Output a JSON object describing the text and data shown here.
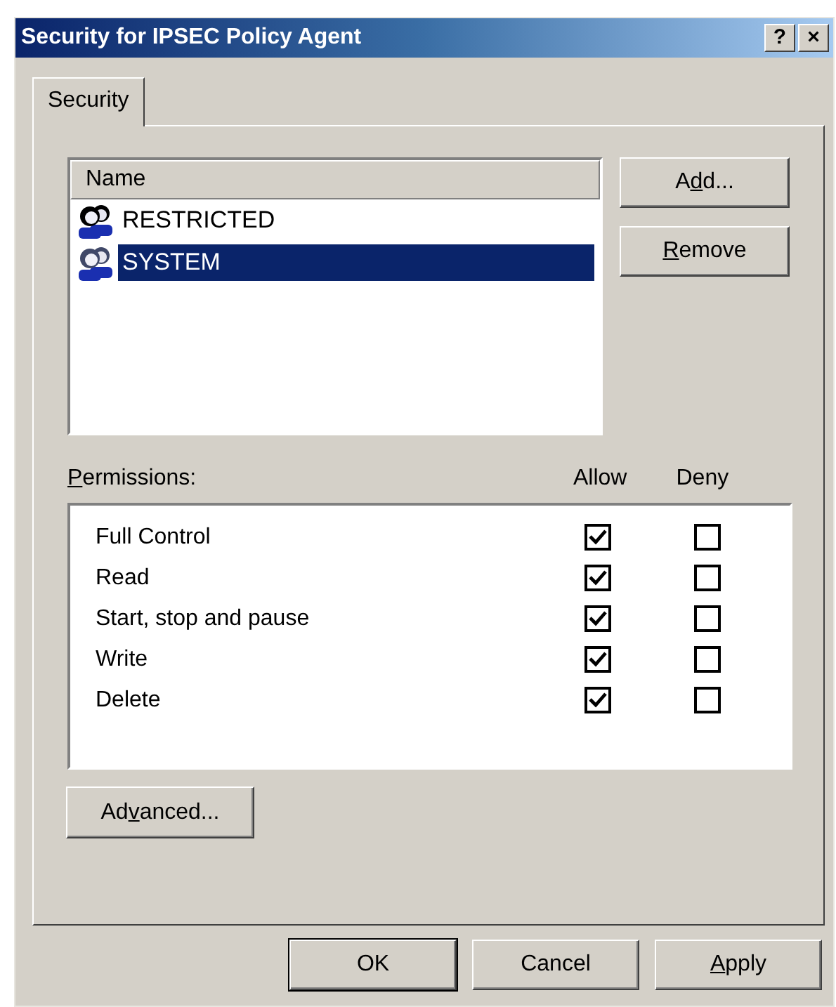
{
  "window": {
    "title": "Security for IPSEC Policy Agent",
    "title_buttons": [
      "?",
      "×"
    ]
  },
  "tabs": [
    {
      "label": "Security",
      "selected": true
    }
  ],
  "names": {
    "column": "Name",
    "items": [
      {
        "name": "RESTRICTED",
        "selected": false
      },
      {
        "name": "SYSTEM",
        "selected": true
      }
    ]
  },
  "name_buttons": [
    {
      "label": [
        {
          "text": "A",
          "underlined": false
        },
        {
          "text": "d",
          "underlined": true
        },
        {
          "text": "d...",
          "underlined": false
        }
      ]
    },
    {
      "label": [
        {
          "text": "R",
          "underlined": true
        },
        {
          "text": "emove",
          "underlined": false
        }
      ]
    }
  ],
  "permissions": {
    "label": [
      {
        "text": "P",
        "underlined": true
      },
      {
        "text": "ermissions:",
        "underlined": false
      }
    ],
    "allow_header": "Allow",
    "deny_header": "Deny",
    "rows": [
      {
        "name": "Full Control",
        "allow": true,
        "deny": false
      },
      {
        "name": "Read",
        "allow": true,
        "deny": false
      },
      {
        "name": "Start, stop and pause",
        "allow": true,
        "deny": false
      },
      {
        "name": "Write",
        "allow": true,
        "deny": false
      },
      {
        "name": "Delete",
        "allow": true,
        "deny": false
      }
    ]
  },
  "advanced_button": {
    "label": [
      {
        "text": "Ad",
        "underlined": false
      },
      {
        "text": "v",
        "underlined": true
      },
      {
        "text": "anced...",
        "underlined": false
      }
    ]
  },
  "buttons": [
    {
      "label": [
        {
          "text": "OK",
          "underlined": false
        }
      ],
      "default": true
    },
    {
      "label": [
        {
          "text": "Cancel",
          "underlined": false
        }
      ],
      "default": false
    },
    {
      "label": [
        {
          "text": "A",
          "underlined": true
        },
        {
          "text": "pply",
          "underlined": false
        }
      ],
      "default": false
    }
  ]
}
